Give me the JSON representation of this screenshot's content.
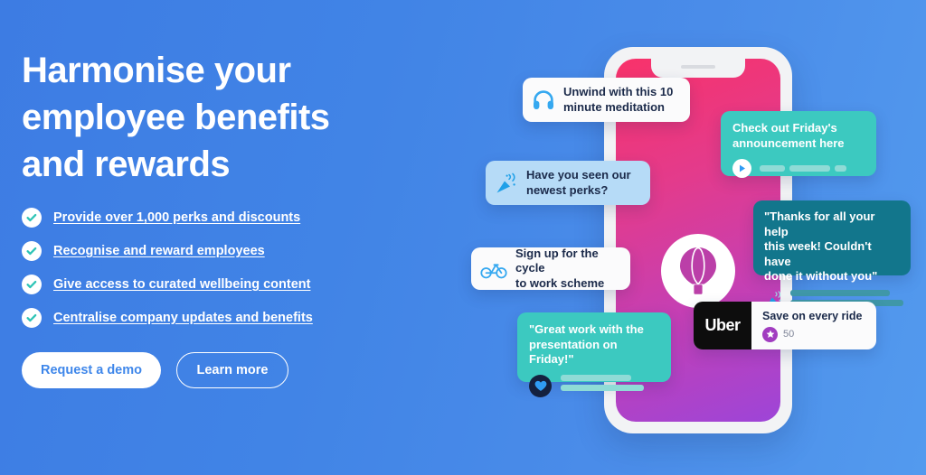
{
  "hero": {
    "headline": "Harmonise your employee benefits and rewards",
    "background_color_left": "#3d7ce3",
    "background_color_right": "#539aee"
  },
  "bullets": [
    {
      "label": "Provide over 1,000 perks and discounts",
      "icon": "check-circle-icon"
    },
    {
      "label": "Recognise and reward employees",
      "icon": "check-circle-icon"
    },
    {
      "label": "Give access to curated wellbeing content",
      "icon": "check-circle-icon"
    },
    {
      "label": "Centralise company updates and benefits",
      "icon": "check-circle-icon"
    }
  ],
  "buttons": {
    "primary_label": "Request a demo",
    "secondary_label": "Learn more",
    "primary_text_color": "#3f87ea",
    "primary_bg_color": "#ffffff"
  },
  "phone": {
    "screen_gradient_start": "#f8326a",
    "screen_gradient_end": "#9d45d8",
    "center_icon": "hot-air-balloon-icon",
    "center_icon_color": "#bb3fa8"
  },
  "cards": {
    "meditation": {
      "icon": "headphones-icon",
      "icon_color": "#35a8f0",
      "line1": "Unwind with this 10",
      "line2": "minute meditation",
      "bg_color": "#fbfbfc"
    },
    "announcement": {
      "line1": "Check out Friday's",
      "line2": "announcement here",
      "icon": "play-icon",
      "bg_color": "#3cc9c0"
    },
    "perks": {
      "icon": "party-popper-icon",
      "icon_color": "#1fa0e8",
      "line1": "Have you seen our",
      "line2": "newest perks?",
      "bg_color": "#b6dbf7"
    },
    "thanks": {
      "line1": "\"Thanks for all your help",
      "line2": "this week! Couldn't have",
      "line3": "done it without you\"",
      "icon": "party-popper-icon",
      "bg_color": "#12768c"
    },
    "cycle": {
      "icon": "bicycle-icon",
      "icon_color": "#35a8f0",
      "line1": "Sign up for the cycle",
      "line2": "to work scheme",
      "bg_color": "#fbfbfc"
    },
    "greatwork": {
      "line1": "\"Great work with the",
      "line2": "presentation on Friday!\"",
      "icon": "heart-icon",
      "icon_color": "#2f9cf4",
      "bg_color": "#3cc9c0"
    },
    "uber": {
      "brand": "Uber",
      "title": "Save on every ride",
      "points": "50",
      "badge_icon": "star-icon",
      "badge_color": "#a13cc0"
    }
  }
}
